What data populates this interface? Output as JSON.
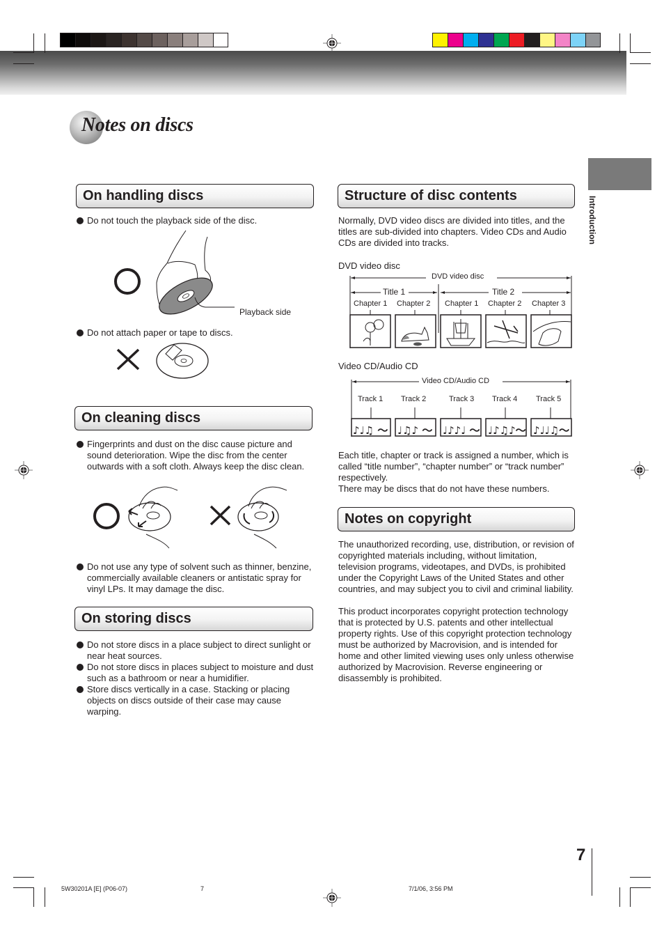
{
  "print_marks": {
    "grayscale_swatches": [
      "#000000",
      "#0e0b0a",
      "#1c1715",
      "#2a2422",
      "#3d3330",
      "#544a47",
      "#6c615e",
      "#8a7f7c",
      "#a89e9b",
      "#cfc8c6",
      "#ffffff"
    ],
    "color_swatches": [
      "#fff200",
      "#ec008c",
      "#00aeef",
      "#2e3192",
      "#00a651",
      "#ed1c24",
      "#231f20",
      "#fff685",
      "#f384c7",
      "#7dd3f7",
      "#939598"
    ]
  },
  "page": {
    "title": "Notes on discs",
    "side_tab_label": "Introduction",
    "page_number": "7"
  },
  "handling": {
    "heading": "On handling discs",
    "bullet1": "Do not touch the playback side of the disc.",
    "callout_label": "Playback side",
    "bullet2": "Do not attach paper or tape to discs."
  },
  "cleaning": {
    "heading": "On cleaning discs",
    "bullet1": "Fingerprints and dust on the disc cause picture and sound deterioration. Wipe the disc from the center outwards with a soft cloth. Always keep the disc clean.",
    "bullet2": "Do not use any type of solvent such as thinner, benzine, commercially available cleaners or antistatic spray for vinyl LPs. It may damage the disc."
  },
  "storing": {
    "heading": "On storing discs",
    "bullets": [
      "Do not store discs in a place subject to direct sunlight or near heat sources.",
      "Do not store discs in places subject to moisture and dust such as a bathroom or near a humidifier.",
      "Store discs vertically in a case. Stacking or placing objects on discs outside of their case may cause warping."
    ]
  },
  "structure": {
    "heading": "Structure of disc contents",
    "intro": "Normally, DVD video discs are divided into titles, and the titles are sub-divided into chapters. Video CDs and Audio CDs are divided into tracks.",
    "dvd_caption": "DVD video disc",
    "dvd_diagram": {
      "span_label": "DVD video disc",
      "titles": [
        "Title 1",
        "Title 2"
      ],
      "chapters": [
        {
          "label": "Chapter 1",
          "picture": "sunflowers"
        },
        {
          "label": "Chapter 2",
          "picture": "cat"
        },
        {
          "label": "Chapter 1",
          "picture": "sailing-ship"
        },
        {
          "label": "Chapter 2",
          "picture": "airplane"
        },
        {
          "label": "Chapter 3",
          "picture": "car"
        }
      ]
    },
    "vcd_caption": "Video CD/Audio CD",
    "vcd_diagram": {
      "span_label": "Video CD/Audio CD",
      "tracks": [
        {
          "label": "Track 1",
          "notes": "♪♩♫ ～"
        },
        {
          "label": "Track 2",
          "notes": "♩♫♪ ～"
        },
        {
          "label": "Track 3",
          "notes": "♩♪♪♩ ～"
        },
        {
          "label": "Track 4",
          "notes": "♩♪♫♪～"
        },
        {
          "label": "Track 5",
          "notes": "♪♩♩♫～"
        }
      ]
    },
    "numbering_p1": "Each title, chapter or track is assigned a number, which is called “title number”, “chapter number” or “track number” respectively.",
    "numbering_p2": "There may be discs that do not have these numbers."
  },
  "copyright": {
    "heading": "Notes on copyright",
    "para1": "The unauthorized recording, use, distribution, or revision of copyrighted materials including, without limitation, television programs, videotapes, and DVDs, is prohibited under the Copyright Laws of the United States and other countries, and may subject you to civil and criminal liability.",
    "para2": "This product incorporates copyright protection technology that is protected by U.S. patents and other intellectual property rights. Use of this copyright protection technology must be authorized by Macrovision, and is intended for home and other limited viewing uses only unless otherwise authorized by Macrovision. Reverse engineering or disassembly is prohibited."
  },
  "footer": {
    "doc_code": "5W30201A [E] (P06-07)",
    "page": "7",
    "timestamp": "7/1/06, 3:56 PM"
  }
}
